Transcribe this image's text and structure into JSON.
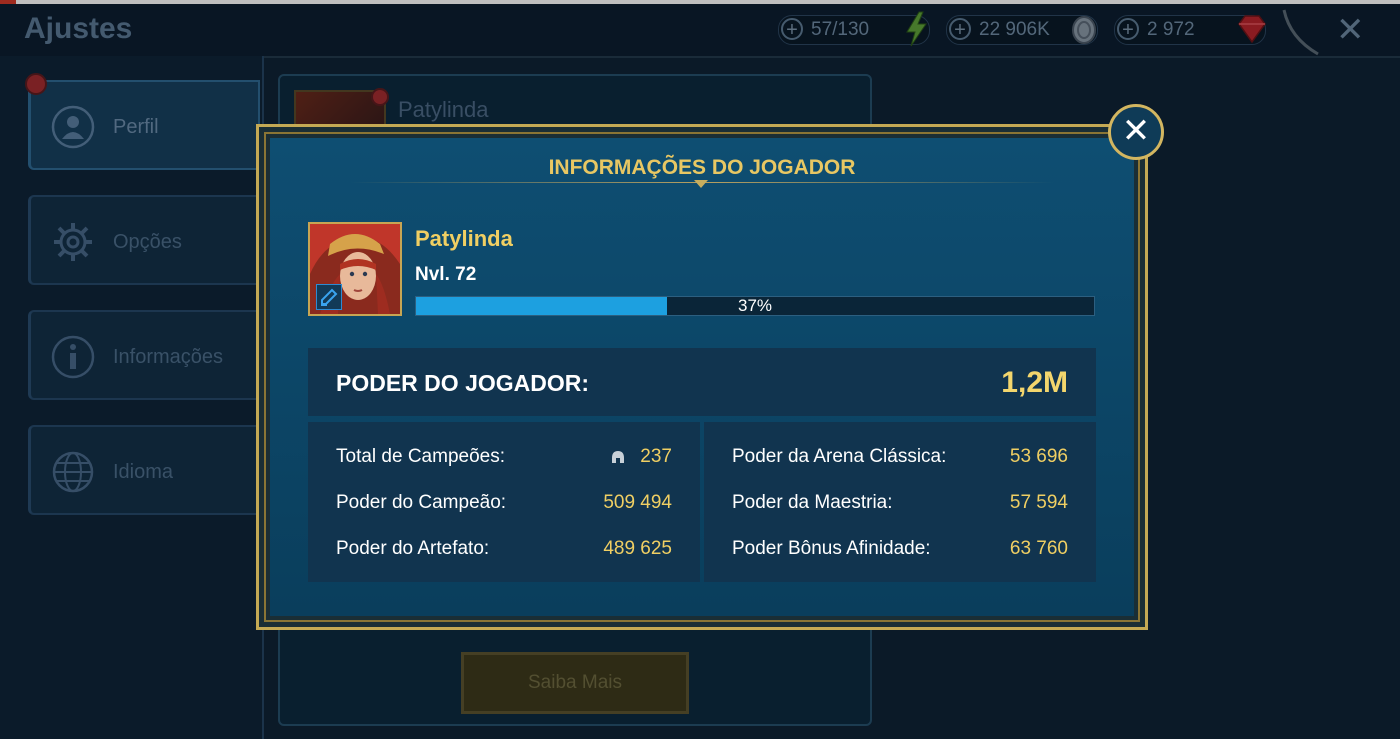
{
  "app_title": "Ajustes",
  "resources": [
    {
      "value": "57/130",
      "icon": "energy-icon"
    },
    {
      "value": "22 906K",
      "icon": "silver-coin-icon"
    },
    {
      "value": "2 972",
      "icon": "ruby-gem-icon"
    }
  ],
  "sidebar": {
    "items": [
      {
        "label": "Perfil",
        "icon": "profile-icon",
        "active": true
      },
      {
        "label": "Opções",
        "icon": "gear-icon"
      },
      {
        "label": "Informações",
        "icon": "info-icon"
      },
      {
        "label": "Idioma",
        "icon": "globe-icon"
      }
    ]
  },
  "background_panel": {
    "name": "Patylinda",
    "button": "Saiba Mais"
  },
  "modal": {
    "title": "INFORMAÇÕES DO JOGADOR",
    "player": {
      "name": "Patylinda",
      "level": "Nvl. 72",
      "xp_percent": 37,
      "xp_label": "37%"
    },
    "power": {
      "label": "PODER DO JOGADOR:",
      "value": "1,2M"
    },
    "stats_left": [
      {
        "label": "Total de Campeões:",
        "value": "237",
        "icon": "helmet-icon"
      },
      {
        "label": "Poder do Campeão:",
        "value": "509 494"
      },
      {
        "label": "Poder do Artefato:",
        "value": "489 625"
      }
    ],
    "stats_right": [
      {
        "label": "Poder da Arena Clássica:",
        "value": "53 696"
      },
      {
        "label": "Poder da Maestria:",
        "value": "57 594"
      },
      {
        "label": "Poder Bônus Afinidade:",
        "value": "63 760"
      }
    ]
  },
  "colors": {
    "gold": "#f0cf63",
    "xp_bar": "#1da0e0",
    "panel": "#0e4e72"
  }
}
